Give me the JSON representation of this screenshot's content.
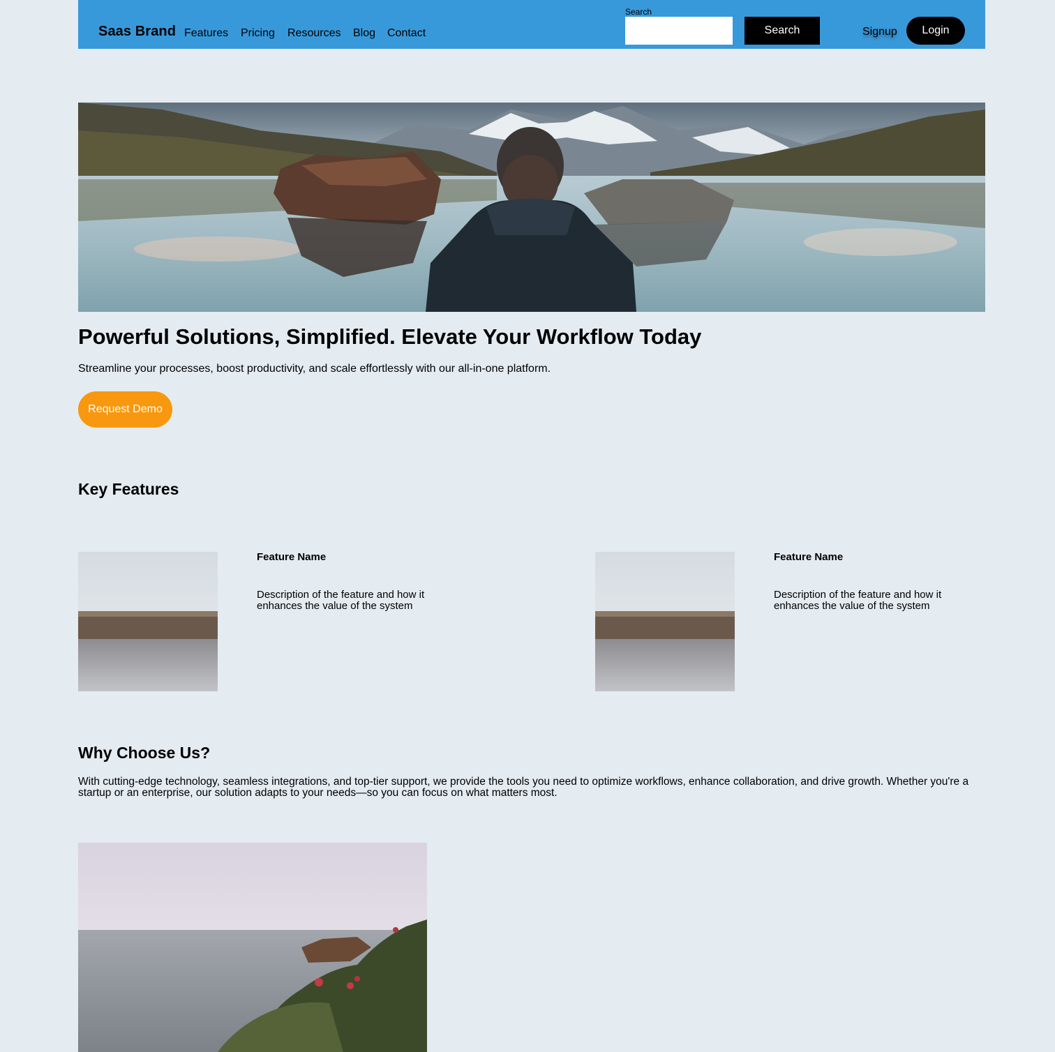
{
  "header": {
    "brand": "Saas Brand",
    "nav": [
      "Features",
      "Pricing",
      "Resources",
      "Blog",
      "Contact"
    ],
    "search_label": "Search",
    "search_placeholder": "",
    "search_button": "Search",
    "signup": "Signup",
    "login": "Login",
    "bg_color": "#3899da"
  },
  "hero": {
    "title": "Powerful Solutions, Simplified. Elevate Your Workflow Today",
    "subtitle": "Streamline your processes, boost productivity, and scale effortlessly with our all-in-one platform.",
    "cta": "Request Demo",
    "cta_color": "#f7980f"
  },
  "features": {
    "title": "Key Features",
    "items": [
      {
        "name": "Feature Name",
        "description": "Description of the feature and how it enhances the value of the system"
      },
      {
        "name": "Feature Name",
        "description": "Description of the feature and how it enhances the value of the system"
      }
    ]
  },
  "why": {
    "title": "Why Choose Us?",
    "text": "With cutting-edge technology, seamless integrations, and top-tier support, we provide the tools you need to optimize workflows, enhance collaboration, and drive growth. Whether you're a startup or an enterprise, our solution adapts to your needs—so you can focus on what matters most."
  }
}
